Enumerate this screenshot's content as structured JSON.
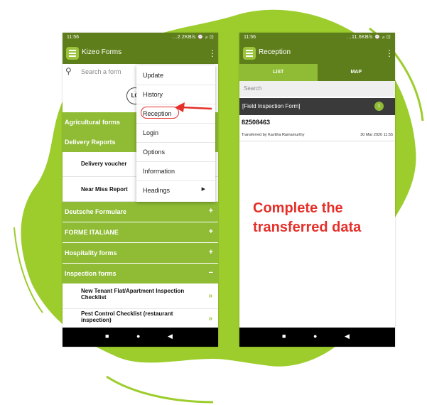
{
  "left_phone": {
    "status": {
      "time": "11:56",
      "network": "…2.2KB/s ⌚ ᵢₗₗ ⊡"
    },
    "app_title": "Kizeo Forms",
    "search_placeholder": "Search a form",
    "logo_text": "LC",
    "categories": [
      {
        "label": "Agricultural forms",
        "symbol": ""
      },
      {
        "label": "Delivery Reports",
        "symbol": ""
      }
    ],
    "delivery_items": [
      {
        "label": "Delivery voucher"
      },
      {
        "label": "Near Miss Report"
      }
    ],
    "more_categories": [
      {
        "label": "Deutsche Formulare",
        "symbol": "+"
      },
      {
        "label": "FORME ITALIANE",
        "symbol": "+"
      },
      {
        "label": "Hospitality forms",
        "symbol": "+"
      },
      {
        "label": "Inspection forms",
        "symbol": "−"
      }
    ],
    "inspection_items": [
      {
        "label": "New Tenant Flat/Apartment Inspection Checklist"
      },
      {
        "label": "Pest Control Checklist (restaurant inspection)"
      }
    ],
    "menu": [
      {
        "label": "Update"
      },
      {
        "label": "History"
      },
      {
        "label": "Reception"
      },
      {
        "label": "Login"
      },
      {
        "label": "Options"
      },
      {
        "label": "Information"
      },
      {
        "label": "Headings",
        "has_submenu": true
      }
    ]
  },
  "right_phone": {
    "status": {
      "time": "11:56",
      "network": "…11.6KB/s ⌚ ᵢₗₗ ⊡"
    },
    "app_title": "Reception",
    "tabs": [
      "LIST",
      "MAP"
    ],
    "active_tab": "LIST",
    "search_placeholder": "Search",
    "form_group": {
      "label": "[Field Inspection Form]",
      "count": "1"
    },
    "record": {
      "id": "82508463",
      "transferred_by": "Transferred by Kavitha Ramamurthy",
      "date": "30 Mar 2020 11:55"
    }
  },
  "caption": {
    "line1": "Complete the",
    "line2": "transferred data"
  },
  "colors": {
    "app_bar": "#5e7e1b",
    "category_green": "#8fbc34",
    "accent_red": "#e5302a",
    "splash_green": "#9ccd2c"
  }
}
